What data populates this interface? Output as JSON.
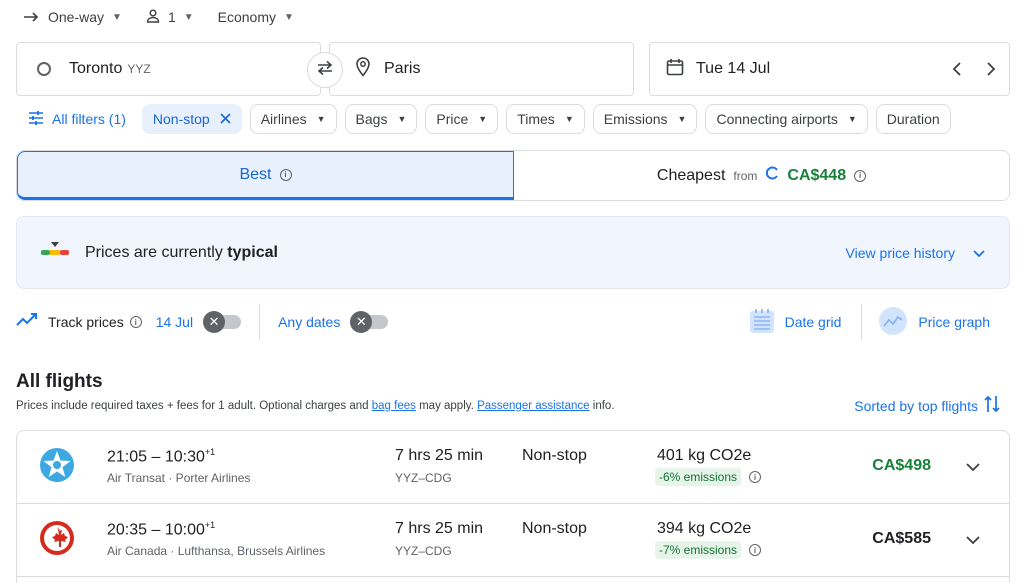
{
  "trip_options": {
    "trip_type": "One-way",
    "passengers": "1",
    "cabin": "Economy"
  },
  "search": {
    "origin_city": "Toronto",
    "origin_code": "YYZ",
    "destination": "Paris",
    "date": "Tue 14 Jul"
  },
  "filters": {
    "all_filters": "All filters (1)",
    "chips": [
      "Non-stop",
      "Airlines",
      "Bags",
      "Price",
      "Times",
      "Emissions",
      "Connecting airports",
      "Duration"
    ]
  },
  "tabs": {
    "best": "Best",
    "cheapest": "Cheapest",
    "from": "from",
    "cheapest_price": "CA$448"
  },
  "insight": {
    "text_prefix": "Prices are currently",
    "level": "typical",
    "view_history": "View price history"
  },
  "tracking": {
    "track_prices": "Track prices",
    "date": "14 Jul",
    "any_dates": "Any dates",
    "date_grid": "Date grid",
    "price_graph": "Price graph"
  },
  "results": {
    "title": "All flights",
    "note_prefix": "Prices include required taxes + fees for 1 adult. Optional charges and",
    "bag_fees": "bag fees",
    "note_mid": "may apply.",
    "passenger_assistance": "Passenger assistance",
    "note_suffix": "info.",
    "sorted_by": "Sorted by top flights",
    "flights": [
      {
        "depart": "21:05",
        "arrive": "10:30",
        "day_offset": "+1",
        "airlines": "Air Transat · Porter Airlines",
        "duration": "7 hrs 25 min",
        "route": "YYZ–CDG",
        "stops": "Non-stop",
        "co2": "401 kg CO2e",
        "emissions": "-6% emissions",
        "price": "CA$498"
      },
      {
        "depart": "20:35",
        "arrive": "10:00",
        "day_offset": "+1",
        "airlines": "Air Canada · Lufthansa, Brussels Airlines",
        "duration": "7 hrs 25 min",
        "route": "YYZ–CDG",
        "stops": "Non-stop",
        "co2": "394 kg CO2e",
        "emissions": "-7% emissions",
        "price": "CA$585"
      }
    ]
  },
  "colors": {
    "accent": "#1a73e8",
    "price_green": "#188038"
  }
}
